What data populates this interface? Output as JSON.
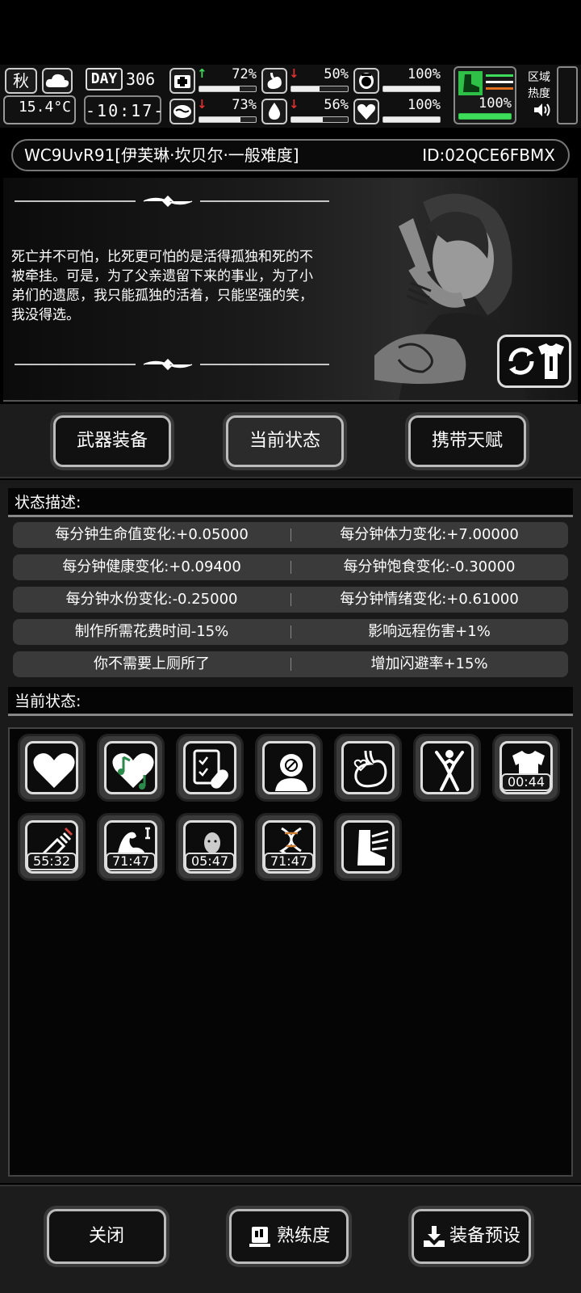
{
  "hud": {
    "season": "秋",
    "weather_icon": "cloud-icon",
    "temperature": "15.4°C",
    "day_label": "DAY",
    "day_number": "306",
    "time": "-10:17-",
    "stats": [
      {
        "icon": "medkit-icon",
        "arrow": "↑",
        "arrow_color": "#3ddc5a",
        "percent": "72%",
        "level": 0.72
      },
      {
        "icon": "stomach-icon",
        "arrow": "↓",
        "arrow_color": "#e03030",
        "percent": "50%",
        "level": 0.5
      },
      {
        "icon": "toilet-icon",
        "arrow": "",
        "arrow_color": "",
        "percent": "100%",
        "level": 1.0
      },
      {
        "icon": "brain-icon",
        "arrow": "↓",
        "arrow_color": "#e03030",
        "percent": "73%",
        "level": 0.73
      },
      {
        "icon": "water-drop-icon",
        "arrow": "↓",
        "arrow_color": "#e03030",
        "percent": "56%",
        "level": 0.56
      },
      {
        "icon": "heart-icon",
        "arrow": "",
        "arrow_color": "",
        "percent": "100%",
        "level": 1.0
      }
    ],
    "stamina_icon": "boot-icon",
    "stamina_percent": "100%",
    "stamina_level": 1.0,
    "stamina_color": "#3ddc5a",
    "region_label": "区域热度",
    "sound_icon": "speaker-icon"
  },
  "character": {
    "title": "WC9UvR91[伊芙琳·坎贝尔·一般难度]",
    "id": "ID:02QCE6FBMX",
    "quote": "死亡并不可怕，比死更可怕的是活得孤独和死的不被牵挂。可是，为了父亲遗留下来的事业，为了小弟们的遗愿，我只能孤独的活着，只能坚强的笑，我没得选。"
  },
  "tabs": [
    {
      "label": "武器装备",
      "active": false
    },
    {
      "label": "当前状态",
      "active": true
    },
    {
      "label": "携带天赋",
      "active": false
    }
  ],
  "status_section_title": "状态描述:",
  "status_rows": [
    [
      "每分钟生命值变化:+0.05000",
      "每分钟体力变化:+7.00000"
    ],
    [
      "每分钟健康变化:+0.09400",
      "每分钟饱食变化:-0.30000"
    ],
    [
      "每分钟水份变化:-0.25000",
      "每分钟情绪变化:+0.61000"
    ],
    [
      "制作所需花费时间-15%",
      "影响远程伤害+1%"
    ],
    [
      "你不需要上厕所了",
      "增加闪避率+15%"
    ]
  ],
  "current_section_title": "当前状态:",
  "status_icons": [
    {
      "icon": "heart-icon",
      "timer": ""
    },
    {
      "icon": "music-heart-icon",
      "timer": ""
    },
    {
      "icon": "medical-report-icon",
      "timer": ""
    },
    {
      "icon": "head-no-icon",
      "timer": ""
    },
    {
      "icon": "stomach-heart-icon",
      "timer": ""
    },
    {
      "icon": "stretch-figure-icon",
      "timer": ""
    },
    {
      "icon": "shirt-icon",
      "timer": "00:44"
    },
    {
      "icon": "syringe-icon",
      "timer": "55:32"
    },
    {
      "icon": "arm-muscle-icon",
      "timer": "71:47"
    },
    {
      "icon": "face-portrait-icon",
      "timer": "05:47"
    },
    {
      "icon": "dna-icon",
      "timer": "71:47"
    },
    {
      "icon": "winged-boot-icon",
      "timer": ""
    }
  ],
  "bottom": {
    "close_label": "关闭",
    "proficiency_label": "熟练度",
    "preset_label": "装备预设"
  }
}
